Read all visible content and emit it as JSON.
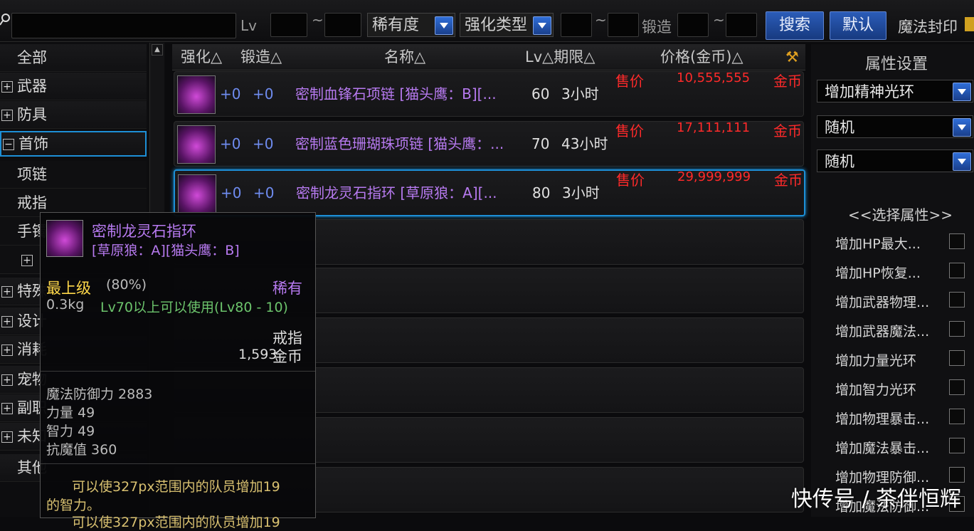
{
  "topbar": {
    "search_placeholder": "",
    "lv_label": "Lv",
    "tilde": "~",
    "rarity_label": "稀有度",
    "enhance_type_label": "强化类型",
    "forge_label": "锻造",
    "search_button": "搜索",
    "default_button": "默认",
    "magic_seal_label": "魔法封印"
  },
  "sidebar": {
    "items": [
      {
        "label": "全部",
        "expand": ""
      },
      {
        "label": "武器",
        "expand": "+"
      },
      {
        "label": "防具",
        "expand": "+"
      },
      {
        "label": "首饰",
        "expand": "−"
      },
      {
        "label": "项链",
        "expand": ""
      },
      {
        "label": "戒指",
        "expand": ""
      },
      {
        "label": "手镯",
        "expand": ""
      },
      {
        "label": "",
        "expand": "+"
      },
      {
        "label": "特殊",
        "expand": "+"
      },
      {
        "label": "设计",
        "expand": "+"
      },
      {
        "label": "消耗",
        "expand": "+"
      },
      {
        "label": "宠物",
        "expand": "+"
      },
      {
        "label": "副职",
        "expand": "+"
      },
      {
        "label": "未知",
        "expand": "+"
      },
      {
        "label": "其他",
        "expand": ""
      }
    ]
  },
  "table": {
    "headers": {
      "enhance": "强化△",
      "forge": "锻造△",
      "name": "名称△",
      "lv_period": "Lv△期限△",
      "price": "价格(金币)△",
      "tool": "⚒"
    },
    "rows": [
      {
        "enhance": "+0",
        "forge": "+0",
        "name": "密制血锋石项链 [猫头鹰：B][...",
        "lv": "60",
        "period": "3小时",
        "sale": "售价",
        "price": "10,555,555",
        "currency": "金币"
      },
      {
        "enhance": "+0",
        "forge": "+0",
        "name": "密制蓝色珊瑚珠项链 [猫头鹰：...",
        "lv": "70",
        "period": "43小时",
        "sale": "售价",
        "price": "17,111,111",
        "currency": "金币"
      },
      {
        "enhance": "+0",
        "forge": "+0",
        "name": "密制龙灵石指环 [草原狼：A][...",
        "lv": "80",
        "period": "3小时",
        "sale": "售价",
        "price": "29,999,999",
        "currency": "金币"
      }
    ]
  },
  "right_panel": {
    "title": "属性设置",
    "dropdown1": "增加精神光环",
    "dropdown2": "随机",
    "dropdown3": "随机",
    "select_title": "<<选择属性>>",
    "attributes": [
      "增加HP最大...",
      "增加HP恢复...",
      "增加武器物理...",
      "增加武器魔法...",
      "增加力量光环",
      "增加智力光环",
      "增加物理暴击...",
      "增加魔法暴击...",
      "增加物理防御...",
      "增加魔法防御..."
    ]
  },
  "tooltip": {
    "name": "密制龙灵石指环",
    "subtitle": "[草原狼：A][猫头鹰：B]",
    "grade": "最上级",
    "grade_pct": "(80%)",
    "rarity": "稀有",
    "weight": "0.3kg",
    "level_req": "Lv70以上可以使用(Lv80 - 10)",
    "type": "戒指",
    "price_value": "1,593",
    "price_unit": "金币",
    "stats": [
      "魔法防御力 2883",
      "力量 49",
      "智力 49",
      "抗魔值 360"
    ],
    "desc_line1": "可以使327px范围内的队员增加19",
    "desc_line2": "的智力。",
    "desc_line3": "可以使327px范围内的队员增加19"
  },
  "watermark": "快传号 / 茶伴恒辉",
  "colors": {
    "accent_blue": "#1d8fd6",
    "item_purple": "#b77af0",
    "price_red": "#ff2a2a",
    "tooltip_gold": "#ffd84a"
  }
}
